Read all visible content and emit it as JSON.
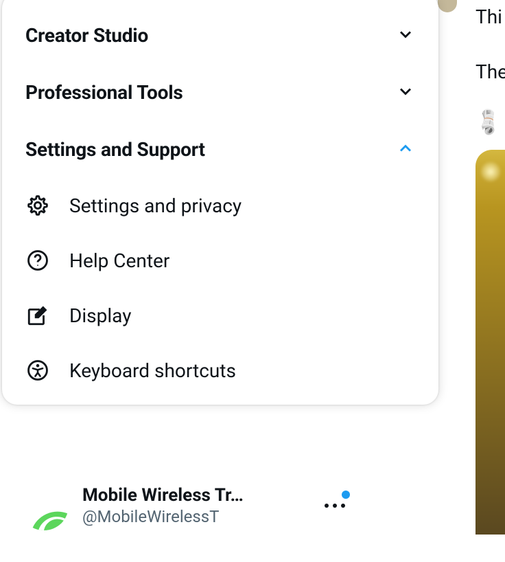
{
  "sections": [
    {
      "title": "Creator Studio",
      "expanded": false
    },
    {
      "title": "Professional Tools",
      "expanded": false
    },
    {
      "title": "Settings and Support",
      "expanded": true
    }
  ],
  "settingsItems": [
    {
      "icon": "gear",
      "label": "Settings and privacy"
    },
    {
      "icon": "help",
      "label": "Help Center"
    },
    {
      "icon": "display",
      "label": "Display"
    },
    {
      "icon": "accessibility",
      "label": "Keyboard shortcuts"
    }
  ],
  "profile": {
    "name": "Mobile Wireless Tr…",
    "handle": "@MobileWirelessT"
  },
  "bgText1": "Thi",
  "bgText2": "The"
}
